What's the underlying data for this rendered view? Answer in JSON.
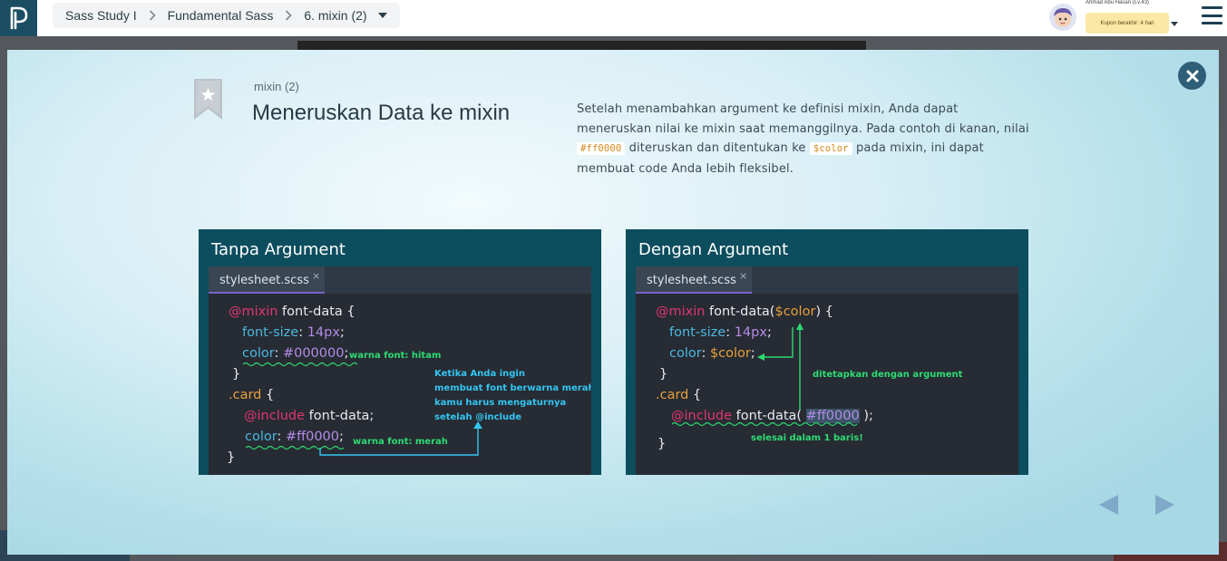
{
  "breadcrumb": {
    "items": [
      "Sass Study I",
      "Fundamental Sass",
      "6. mixin (2)"
    ]
  },
  "user": {
    "name": "Ahmad Abu Hasan (Lv.43)",
    "coupon": "Kupon berakhir: 4 hari"
  },
  "lesson": {
    "subtitle": "mixin (2)",
    "title": "Meneruskan Data ke mixin",
    "desc_1": "Setelah menambahkan argument ke definisi mixin, Anda dapat meneruskan nilai ke mixin saat memanggilnya. Pada contoh di kanan, nilai ",
    "code_1": "#ff0000",
    "desc_2": " diteruskan dan ditentukan ke ",
    "code_2": "$color",
    "desc_3": " pada mixin, ini dapat membuat code Anda lebih fleksibel."
  },
  "slides": {
    "left": {
      "title": "Tanpa Argument",
      "tab": "stylesheet.scss",
      "tab_close": "×",
      "code": {
        "l1_kw": "@mixin",
        "l1_rest": " font-data {",
        "l2_prop": "font-size",
        "l2_colon": ": ",
        "l2_val": "14px",
        "l2_end": ";",
        "l3_prop": "color",
        "l3_colon": ": ",
        "l3_val": "#000000",
        "l3_end": ";",
        "l4": "}",
        "l5_sel": ".card",
        "l5_rest": " {",
        "l6_kw": "@include",
        "l6_rest": " font-data;",
        "l7_prop": "color",
        "l7_colon": ": ",
        "l7_val": "#ff0000",
        "l7_end": ";",
        "l8": "}"
      },
      "annotations": {
        "black": "warna font: hitam",
        "red": "warna font: merah",
        "note_1": "Ketika Anda ingin",
        "note_2": "membuat font berwarna merah,",
        "note_3": "kamu harus mengaturnya",
        "note_4": "setelah @include"
      }
    },
    "right": {
      "title": "Dengan Argument",
      "tab": "stylesheet.scss",
      "tab_close": "×",
      "code": {
        "l1_kw": "@mixin",
        "l1_mid": " font-data(",
        "l1_var": "$color",
        "l1_end": ") {",
        "l2_prop": "font-size",
        "l2_colon": ": ",
        "l2_val": "14px",
        "l2_end": ";",
        "l3_prop": "color",
        "l3_colon": ": ",
        "l3_var": "$color",
        "l3_end": ";",
        "l4": "}",
        "l5_sel": ".card",
        "l5_rest": " {",
        "l6_kw": "@include",
        "l6_mid": " font-data( ",
        "l6_val": "#ff0000",
        "l6_end": " );",
        "l7": "}"
      },
      "annotations": {
        "arg": "ditetapkan dengan argument",
        "done": "selesai dalam 1 baris!"
      }
    }
  },
  "colors": {
    "accent": "#2f5e78",
    "slide_bg": "#0c4d5e",
    "editor_bg": "#272b33",
    "annotation_green": "#2edb73",
    "annotation_blue": "#33c6f2",
    "keyword": "#e0366f",
    "property": "#4bb8e0",
    "number": "#b48be8"
  },
  "icons": {
    "logo": "progate-logo-icon",
    "close": "close-icon",
    "bookmark": "bookmark-star-icon",
    "prev": "prev-arrow-icon",
    "next": "next-arrow-icon",
    "menu": "hamburger-menu-icon"
  }
}
